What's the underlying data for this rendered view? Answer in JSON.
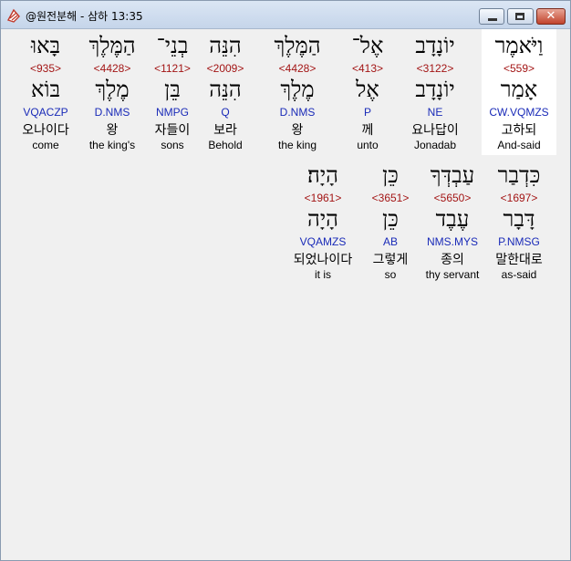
{
  "window": {
    "title": "@원전분해 - 삼하 13:35",
    "minimize_glyph": "",
    "maximize_glyph": "",
    "close_glyph": "✕"
  },
  "row1": [
    {
      "heb": "וַיֹּאמֶר",
      "strong": "<559>",
      "root": "אָמַר",
      "morph": "CW.VQMZS",
      "kor": "고하되",
      "eng": "And-said",
      "selected": true
    },
    {
      "heb": "יוֹנָדָב",
      "strong": "<3122>",
      "root": "יוֹנָדָב",
      "morph": "NE",
      "kor": "요나답이",
      "eng": "Jonadab"
    },
    {
      "heb": "אֶל־",
      "strong": "<413>",
      "root": "אֶל",
      "morph": "P",
      "kor": "께",
      "eng": "unto"
    },
    {
      "heb": "הַמֶּלֶךְ",
      "strong": "<4428>",
      "root": "מֶלֶךְ",
      "morph": "D.NMS",
      "kor": "왕",
      "eng": "the king"
    },
    {
      "heb": "הִנֵּה",
      "strong": "<2009>",
      "root": "הִנֵּה",
      "morph": "Q",
      "kor": "보라",
      "eng": "Behold"
    },
    {
      "heb": "בְנֵי־",
      "strong": "<1121>",
      "root": "בֵּן",
      "morph": "NMPG",
      "kor": "자들이",
      "eng": "sons"
    },
    {
      "heb": "הַמֶּלֶךְ",
      "strong": "<4428>",
      "root": "מֶלֶךְ",
      "morph": "D.NMS",
      "kor": "왕",
      "eng": "the king's"
    },
    {
      "heb": "בָּאוּ",
      "strong": "<935>",
      "root": "בּוֹא",
      "morph": "VQACZP",
      "kor": "오나이다",
      "eng": "come"
    }
  ],
  "row2": [
    {
      "heb": "כִּדְבַר",
      "strong": "<1697>",
      "root": "דָּבָר",
      "morph": "P.NMSG",
      "kor": "말한대로",
      "eng": "as-said"
    },
    {
      "heb": "עַבְדְּךָ",
      "strong": "<5650>",
      "root": "עֶבֶד",
      "morph": "NMS.MYS",
      "kor": "종의",
      "eng": "thy servant"
    },
    {
      "heb": "כֵּן",
      "strong": "<3651>",
      "root": "כֵּן",
      "morph": "AB",
      "kor": "그렇게",
      "eng": "so"
    },
    {
      "heb": "הָיָה׃",
      "strong": "<1961>",
      "root": "הָיָה",
      "morph": "VQAMZS",
      "kor": "되었나이다",
      "eng": "it is"
    }
  ]
}
